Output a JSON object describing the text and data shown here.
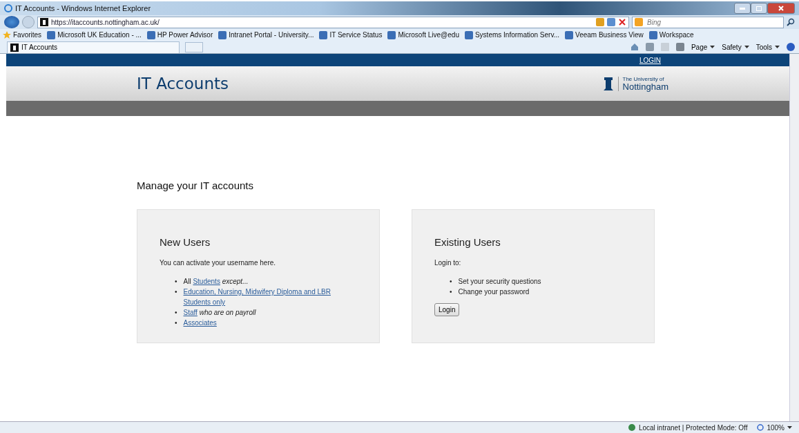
{
  "window": {
    "title": "IT Accounts - Windows Internet Explorer"
  },
  "address_bar": {
    "url": "https://itaccounts.nottingham.ac.uk/",
    "search_placeholder": "Bing"
  },
  "favorites_bar": {
    "label": "Favorites",
    "items": [
      {
        "label": "Microsoft UK Education - ..."
      },
      {
        "label": "HP Power Advisor"
      },
      {
        "label": "Intranet Portal - University..."
      },
      {
        "label": "IT Service Status"
      },
      {
        "label": "Microsoft Live@edu"
      },
      {
        "label": "Systems Information Serv..."
      },
      {
        "label": "Veeam Business View"
      },
      {
        "label": "Workspace"
      }
    ]
  },
  "tab": {
    "label": "IT Accounts"
  },
  "command_bar": [
    "Page",
    "Safety",
    "Tools"
  ],
  "page": {
    "login_link": "LOGIN",
    "site_title": "IT Accounts",
    "logo_small": "The University of",
    "logo_large": "Nottingham",
    "heading": "Manage your IT accounts",
    "cards": [
      {
        "title": "New Users",
        "intro": "You can activate your username here.",
        "bullet": "•",
        "items": [
          [
            {
              "kind": "plain",
              "text": "All"
            },
            {
              "kind": "link",
              "text": "Students"
            },
            {
              "kind": "note",
              "text": "except..."
            }
          ],
          [
            {
              "kind": "link",
              "text": "Education, Nursing, Midwifery Diploma and LBR Students only"
            }
          ],
          [
            {
              "kind": "link",
              "text": "Staff"
            },
            {
              "kind": "note",
              "text": "who are on payroll"
            }
          ],
          [
            {
              "kind": "link",
              "text": "Associates"
            }
          ]
        ]
      },
      {
        "title": "Existing Users",
        "intro": "Login to:",
        "bullet": "•",
        "items": [
          [
            {
              "kind": "plain",
              "text": "Set your security questions"
            }
          ],
          [
            {
              "kind": "plain",
              "text": "Change your password"
            }
          ]
        ],
        "button": "Login"
      }
    ]
  },
  "status_bar": {
    "zone": "Local intranet | Protected Mode: Off",
    "zoom": "100%"
  }
}
